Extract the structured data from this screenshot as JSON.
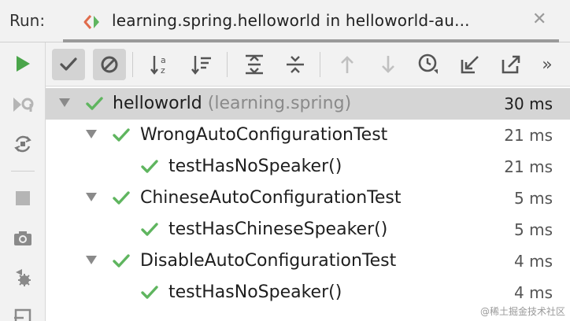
{
  "header": {
    "run_label": "Run:",
    "tab_title": "learning.spring.helloworld in helloworld-au...",
    "close_glyph": "✕"
  },
  "left_toolbar": {
    "icons": [
      "run-icon",
      "rerun-failed-icon",
      "toggle-autotest-icon",
      "stop-icon",
      "camera-icon",
      "debug-gear-icon",
      "import-icon"
    ]
  },
  "toolbar": {
    "icons": [
      "show-passed-icon",
      "show-ignored-icon",
      "sort-alpha-icon",
      "sort-duration-icon",
      "expand-all-icon",
      "collapse-all-icon",
      "prev-failed-icon",
      "next-failed-icon",
      "test-history-icon",
      "import-tests-icon",
      "export-tests-icon",
      "more-icon"
    ],
    "more_glyph": "»"
  },
  "tree": {
    "rows": [
      {
        "name": "helloworld",
        "package": "(learning.spring)",
        "time": "30 ms",
        "level": 0,
        "expandable": true,
        "selected": true
      },
      {
        "name": "WrongAutoConfigurationTest",
        "package": "",
        "time": "21 ms",
        "level": 1,
        "expandable": true,
        "selected": false
      },
      {
        "name": "testHasNoSpeaker()",
        "package": "",
        "time": "21 ms",
        "level": 2,
        "expandable": false,
        "selected": false
      },
      {
        "name": "ChineseAutoConfigurationTest",
        "package": "",
        "time": "5 ms",
        "level": 1,
        "expandable": true,
        "selected": false
      },
      {
        "name": "testHasChineseSpeaker()",
        "package": "",
        "time": "5 ms",
        "level": 2,
        "expandable": false,
        "selected": false
      },
      {
        "name": "DisableAutoConfigurationTest",
        "package": "",
        "time": "4 ms",
        "level": 1,
        "expandable": true,
        "selected": false
      },
      {
        "name": "testHasNoSpeaker()",
        "package": "",
        "time": "4 ms",
        "level": 2,
        "expandable": false,
        "selected": false
      }
    ]
  },
  "colors": {
    "pass_green": "#5fb55f",
    "run_green": "#4aa54a",
    "icon_gray": "#7a7a7a",
    "disabled_gray": "#b5b5b5"
  },
  "watermark": "@稀土掘金技术社区"
}
